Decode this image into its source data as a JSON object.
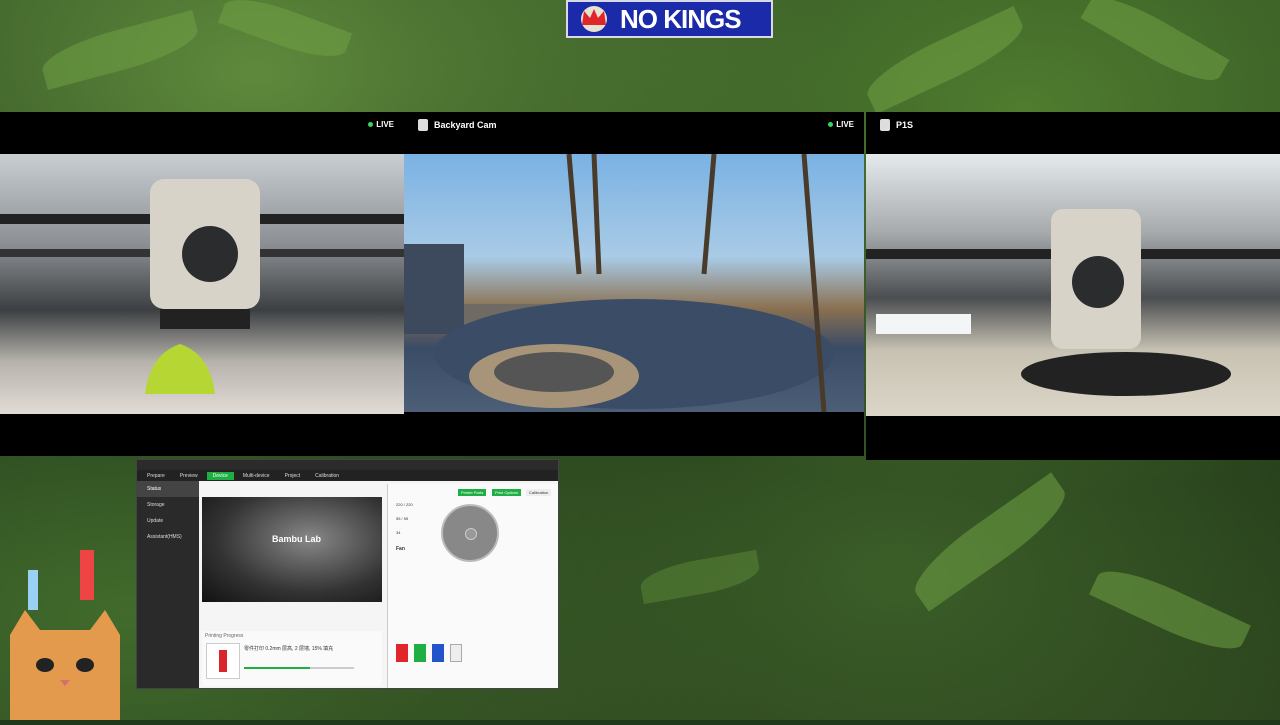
{
  "banner": {
    "text": "NO KINGS"
  },
  "cameras": [
    {
      "title": "",
      "live": "LIVE"
    },
    {
      "title": "Backyard Cam",
      "live": "LIVE"
    },
    {
      "title": "P1S",
      "live": ""
    }
  ],
  "bambu": {
    "tabs": [
      "Prepare",
      "Preview",
      "Device",
      "Multi-device",
      "Project",
      "Calibration"
    ],
    "sidebar": [
      "Status",
      "Storage",
      "Update",
      "Assistant(HMS)"
    ],
    "logo": "Bambu Lab",
    "controls": {
      "part_fan": "Fan",
      "buttons": [
        "Printer Parts",
        "Print Options",
        "Calibration"
      ]
    },
    "temps": [
      "220 / 220",
      "55 / 55",
      "34"
    ],
    "print": {
      "section": "Printing Progress",
      "file": "零件打印 0.2mm 层高, 2 层墙, 15% 填充"
    }
  },
  "colors": {
    "accent": "#1fae43",
    "banner": "#1a2aa8"
  }
}
